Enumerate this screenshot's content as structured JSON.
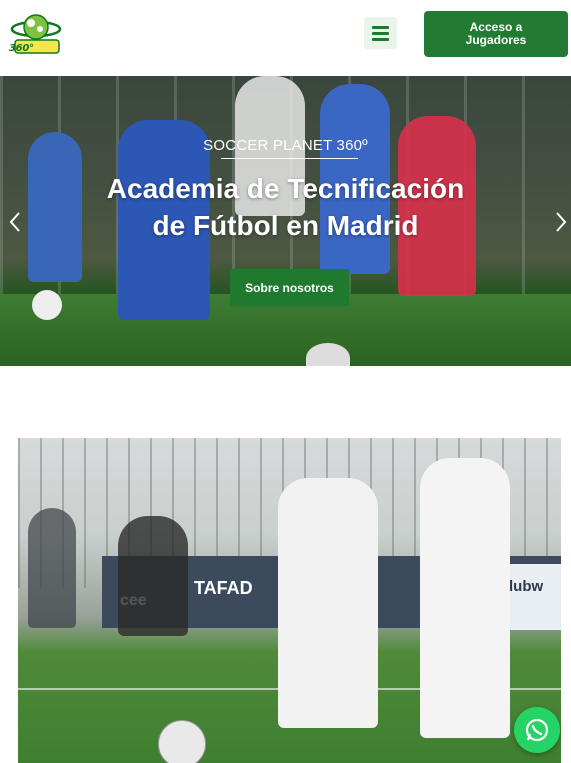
{
  "header": {
    "logo_alt": "360 Soccer Planet",
    "logo_text": "360°",
    "menu_icon": "hamburger-menu-icon",
    "cta_label": "Acceso a\nJugadores"
  },
  "hero": {
    "subtitle": "SOCCER PLANET 360º",
    "title": "Academia de Tecnificación\nde Fútbol en Madrid",
    "button_label": "Sobre nosotros",
    "prev_icon": "chevron-left-icon",
    "next_icon": "chevron-right-icon"
  },
  "photo": {
    "banner_left": "TAFAD",
    "banner_left_small": "cee",
    "banner_right": "iClubw"
  },
  "whatsapp": {
    "icon": "whatsapp-icon"
  },
  "colors": {
    "brand_green": "#237a33",
    "whatsapp_green": "#25d366"
  }
}
